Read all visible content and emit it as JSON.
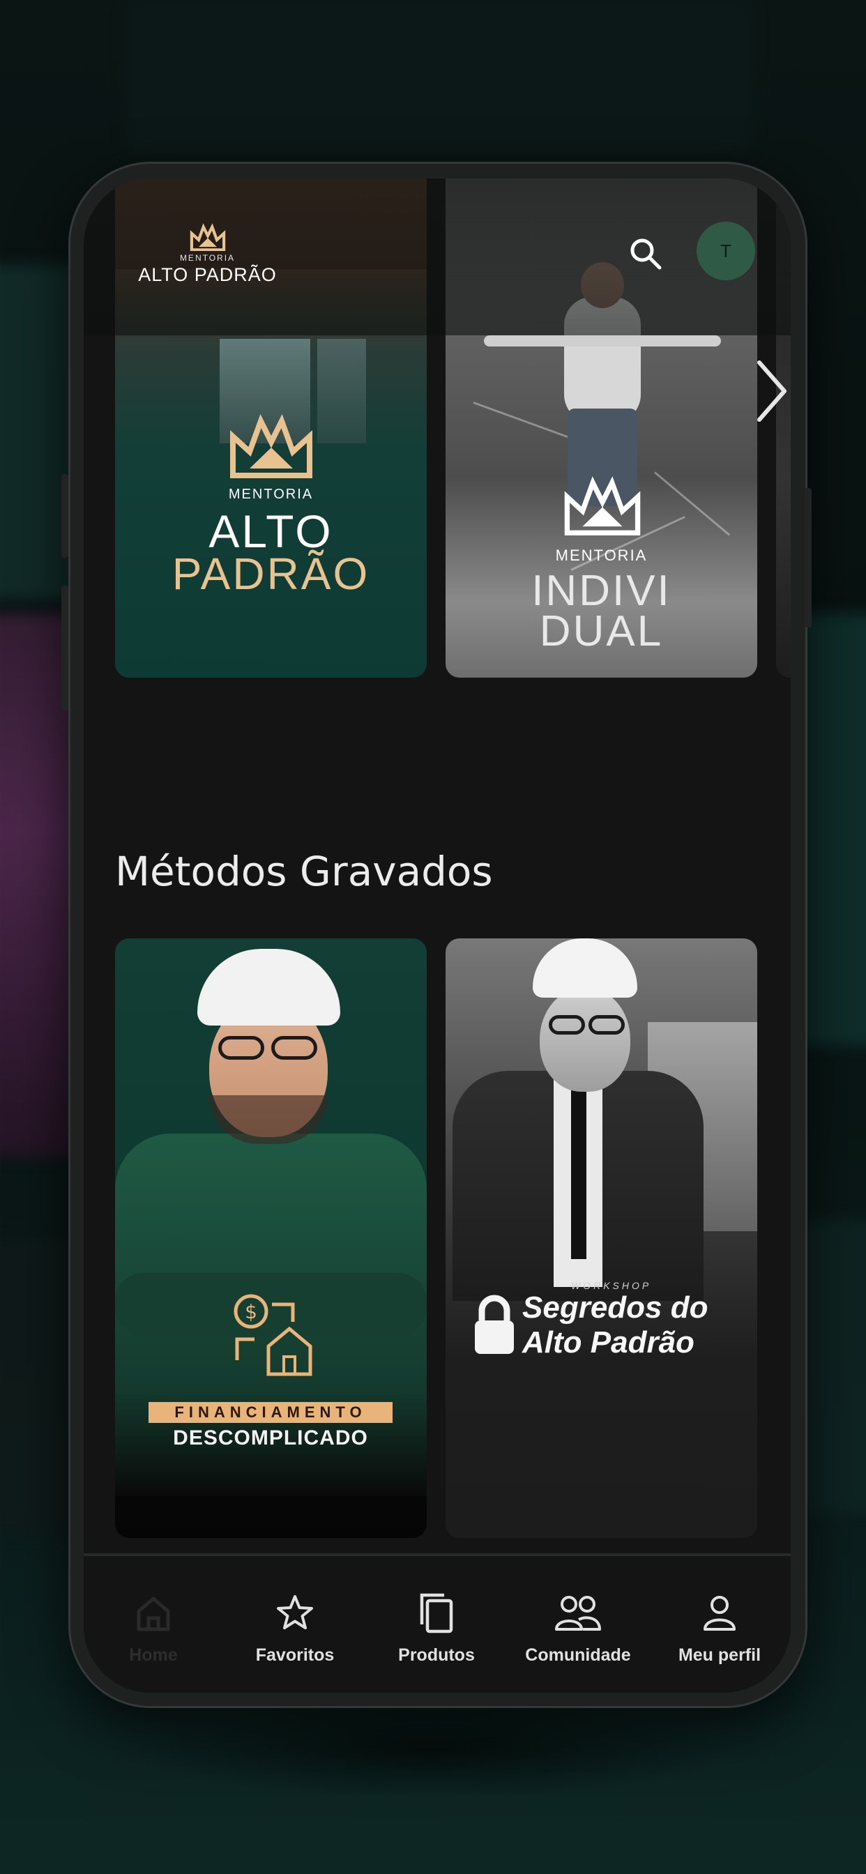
{
  "header": {
    "logo_sub": "MENTORIA",
    "logo_main": "ALTO PADRÃO",
    "avatar_initial": "T",
    "search_icon": "search-icon"
  },
  "banners": [
    {
      "line1": "MENTORIA",
      "line2": "ALTO",
      "line3": "PADRÃO"
    },
    {
      "line1": "MENTORIA",
      "line2": "INDIVI",
      "line3": "DUAL"
    }
  ],
  "section": {
    "title": "Métodos Gravados"
  },
  "cards": [
    {
      "label_top": "FINANCIAMENTO",
      "label_bottom": "DESCOMPLICADO"
    },
    {
      "small": "WORKSHOP",
      "title_line1": "Segredos do",
      "title_line2": "Alto Padrão"
    }
  ],
  "nav": {
    "items": [
      {
        "label": "Home",
        "icon": "home-icon",
        "active": true
      },
      {
        "label": "Favoritos",
        "icon": "star-icon"
      },
      {
        "label": "Produtos",
        "icon": "copy-icon"
      },
      {
        "label": "Comunidade",
        "icon": "community-icon"
      },
      {
        "label": "Meu perfil",
        "icon": "user-icon"
      }
    ]
  },
  "colors": {
    "accent_gold": "#e8c38f",
    "brand_green": "#0f3a32",
    "avatar_green": "#2f5b46",
    "screen_bg": "#141414"
  }
}
